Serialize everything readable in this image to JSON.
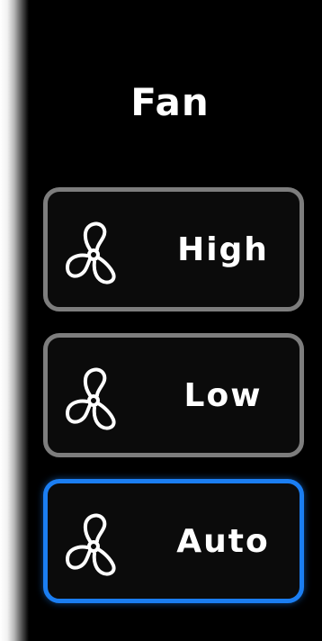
{
  "panel": {
    "title": "Fan"
  },
  "fan_modes": [
    {
      "label": "High",
      "icon": "fan-icon",
      "selected": false
    },
    {
      "label": "Low",
      "icon": "fan-icon",
      "selected": false
    },
    {
      "label": "Auto",
      "icon": "fan-icon",
      "selected": true
    }
  ],
  "colors": {
    "background": "#000000",
    "option_border": "#7d7d7d",
    "selected_border": "#1b7ef2",
    "text": "#ffffff"
  }
}
